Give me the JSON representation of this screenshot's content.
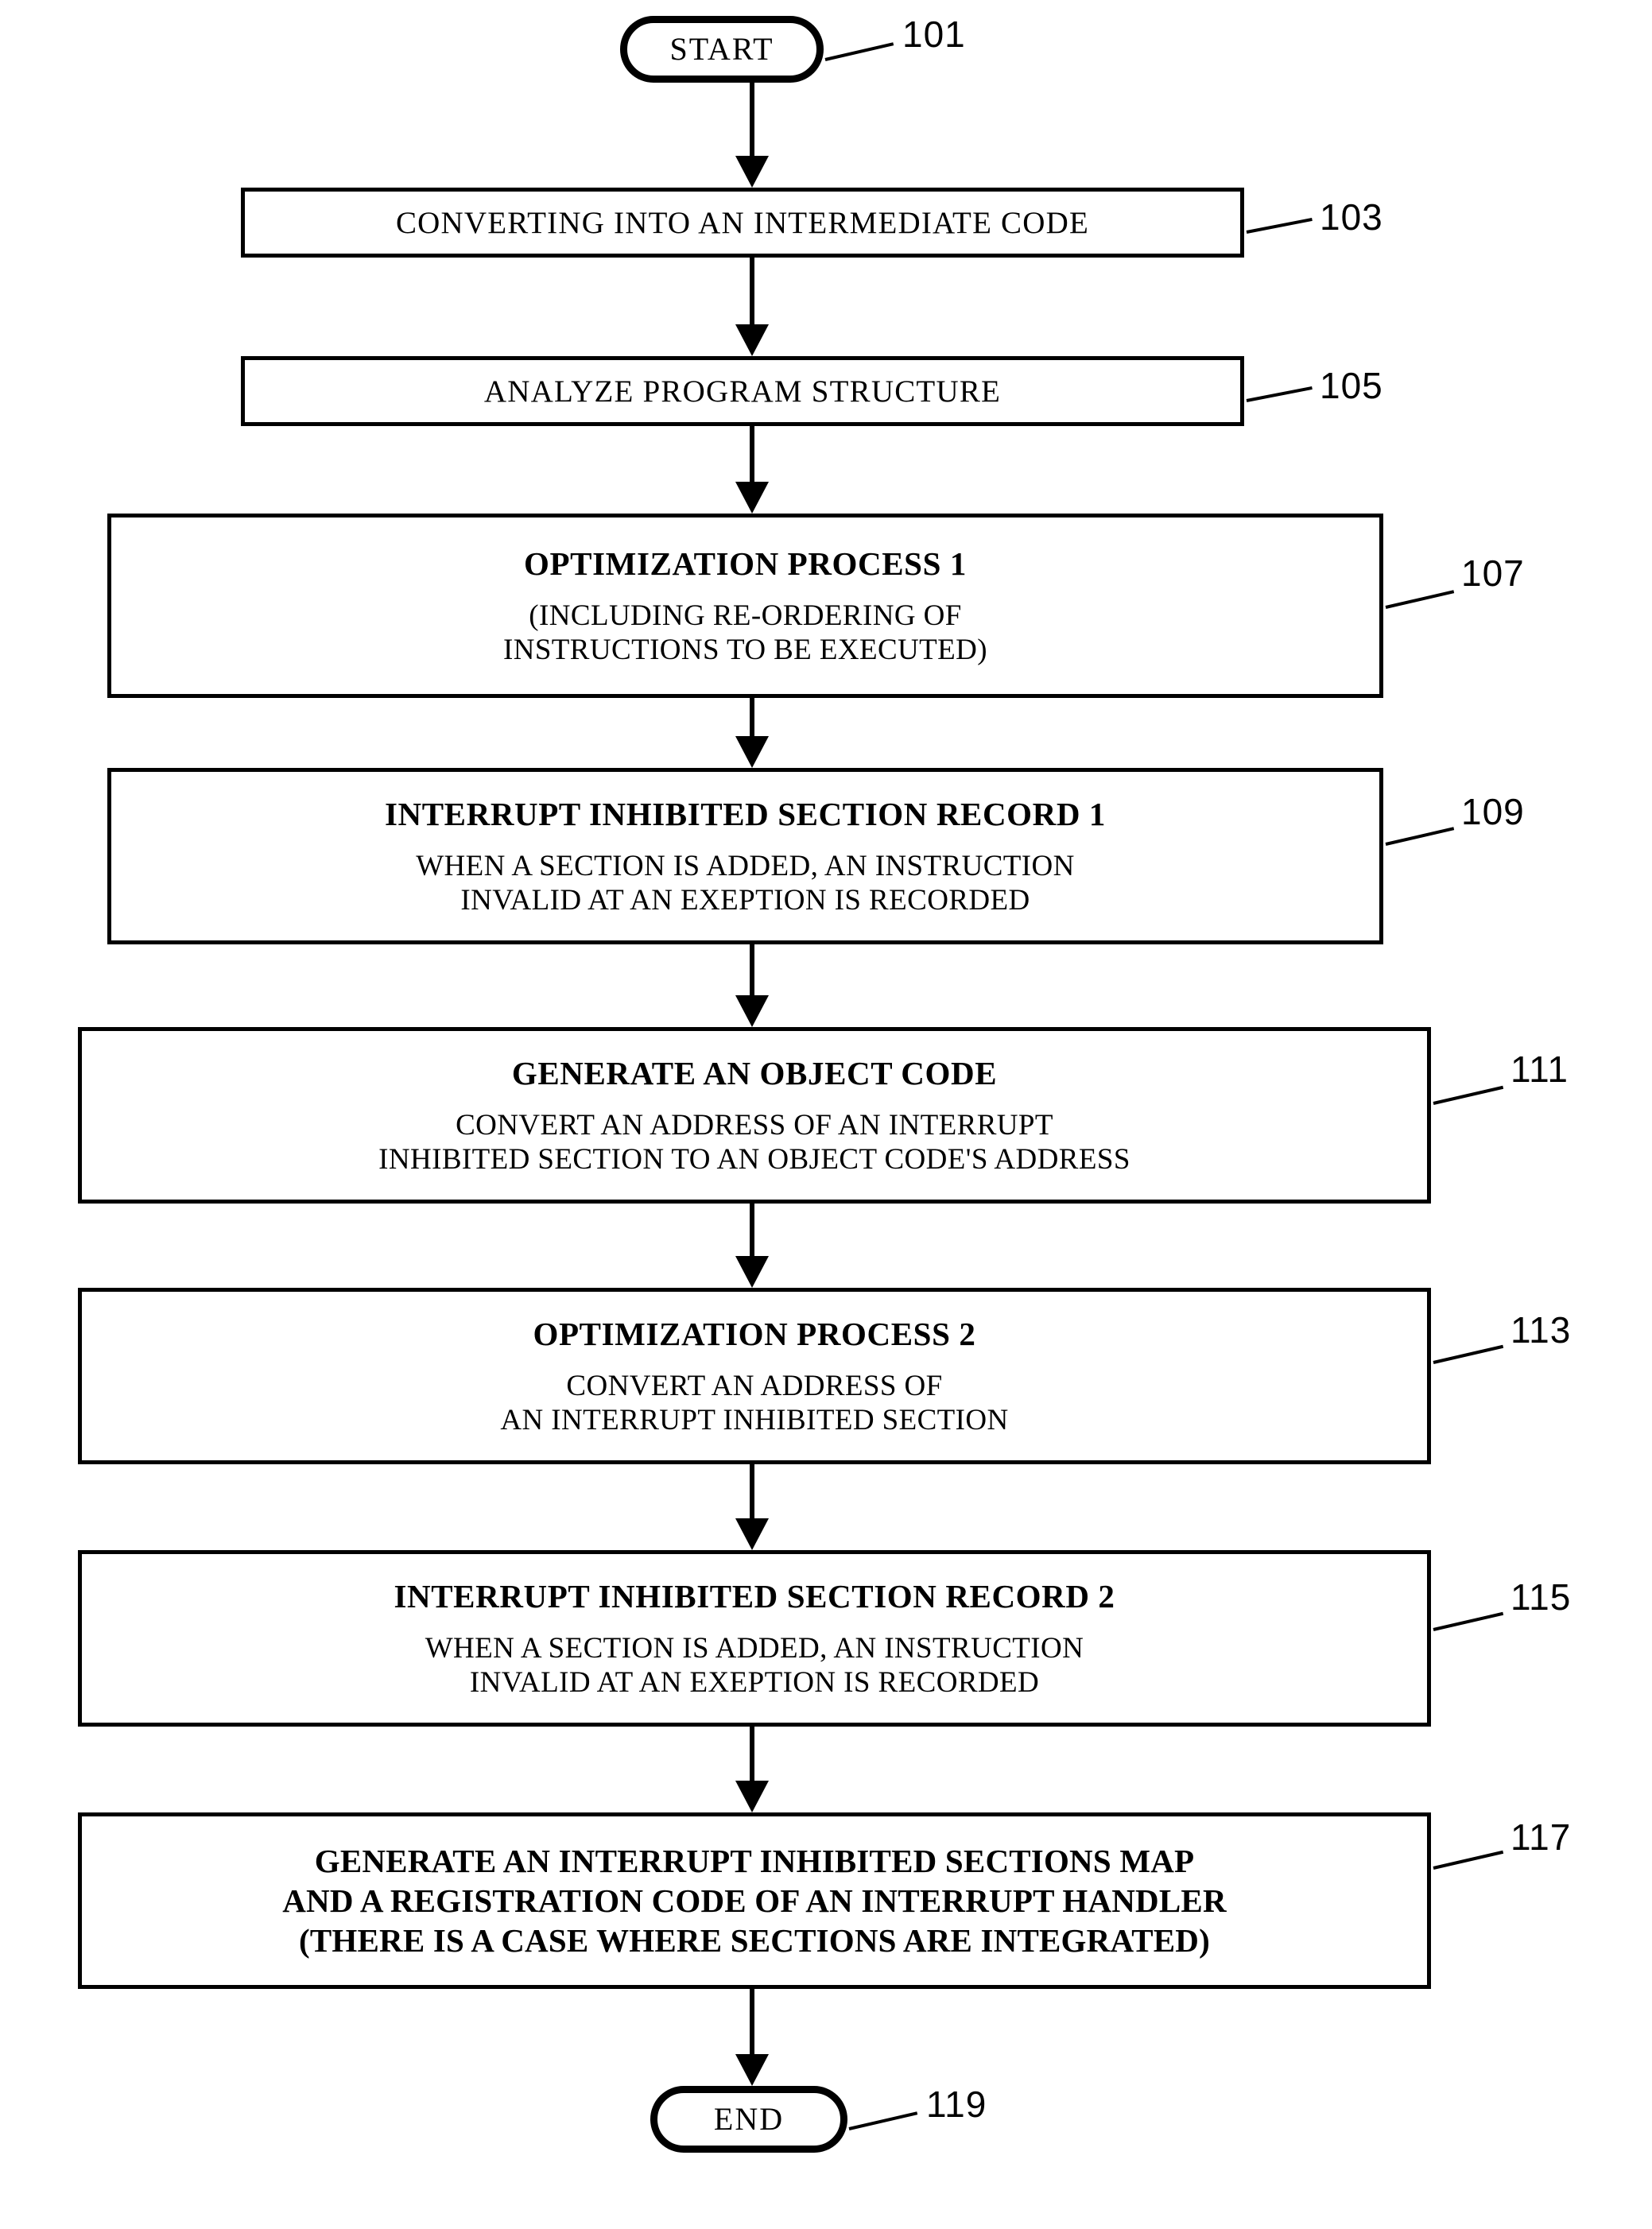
{
  "figure": {
    "title": "Compiler interrupt-inhibited-section processing flowchart",
    "type": "flowchart",
    "orientation": "top-to-bottom"
  },
  "nodes": {
    "start": {
      "ref": "101",
      "shape": "terminal",
      "label": "START"
    },
    "step103": {
      "ref": "103",
      "shape": "process",
      "lines": [
        "CONVERTING INTO AN INTERMEDIATE CODE"
      ]
    },
    "step105": {
      "ref": "105",
      "shape": "process",
      "lines": [
        "ANALYZE PROGRAM STRUCTURE"
      ]
    },
    "step107": {
      "ref": "107",
      "shape": "process",
      "heading": "OPTIMIZATION PROCESS 1",
      "lines": [
        "(INCLUDING RE-ORDERING OF",
        "INSTRUCTIONS TO BE EXECUTED)"
      ]
    },
    "step109": {
      "ref": "109",
      "shape": "process",
      "heading": "INTERRUPT INHIBITED SECTION RECORD 1",
      "lines": [
        "WHEN A SECTION IS ADDED, AN INSTRUCTION",
        "INVALID AT AN EXEPTION IS RECORDED"
      ]
    },
    "step111": {
      "ref": "111",
      "shape": "process",
      "heading": "GENERATE AN OBJECT CODE",
      "lines": [
        "CONVERT AN ADDRESS OF AN INTERRUPT",
        "INHIBITED SECTION TO AN OBJECT CODE'S ADDRESS"
      ]
    },
    "step113": {
      "ref": "113",
      "shape": "process",
      "heading": "OPTIMIZATION PROCESS 2",
      "lines": [
        "CONVERT AN ADDRESS OF",
        "AN INTERRUPT INHIBITED SECTION"
      ]
    },
    "step115": {
      "ref": "115",
      "shape": "process",
      "heading": "INTERRUPT INHIBITED SECTION RECORD 2",
      "lines": [
        "WHEN A SECTION IS ADDED, AN INSTRUCTION",
        "INVALID AT AN EXEPTION IS RECORDED"
      ]
    },
    "step117": {
      "ref": "117",
      "shape": "process",
      "lines": [
        "GENERATE AN INTERRUPT INHIBITED SECTIONS MAP",
        "AND A REGISTRATION CODE OF AN INTERRUPT HANDLER",
        "(THERE IS A CASE WHERE SECTIONS ARE INTEGRATED)"
      ]
    },
    "end": {
      "ref": "119",
      "shape": "terminal",
      "label": "END"
    }
  },
  "colors": {
    "stroke": "#000000",
    "fill": "#ffffff",
    "text": "#000000"
  }
}
